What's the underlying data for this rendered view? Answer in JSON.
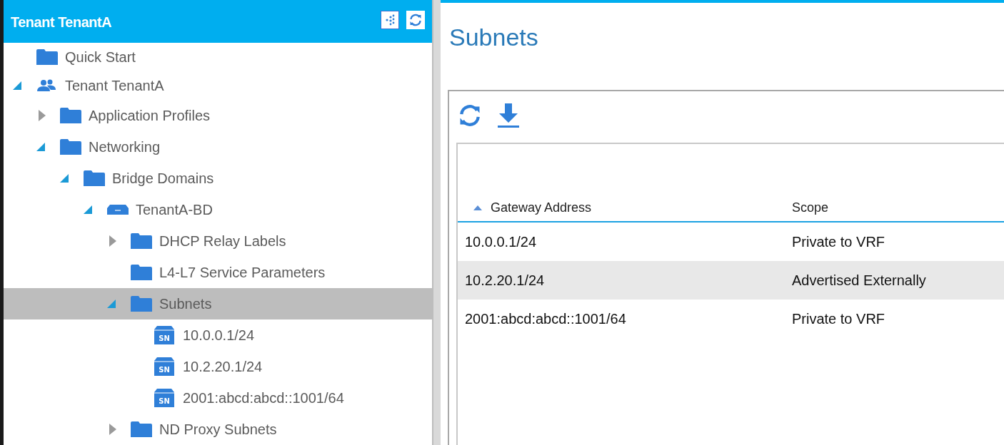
{
  "sidebar": {
    "title": "Tenant TenantA",
    "tree": [
      {
        "label": "Quick Start",
        "kind": "folder",
        "selected": false
      },
      {
        "label": "Tenant TenantA",
        "kind": "tenant",
        "expanded": true,
        "selected": false,
        "children": [
          {
            "label": "Application Profiles",
            "kind": "folder",
            "expanded": false,
            "selected": false
          },
          {
            "label": "Networking",
            "kind": "folder",
            "expanded": true,
            "selected": false,
            "children": [
              {
                "label": "Bridge Domains",
                "kind": "folder",
                "expanded": true,
                "selected": false,
                "children": [
                  {
                    "label": "TenantA-BD",
                    "kind": "bridge-domain",
                    "expanded": true,
                    "selected": false,
                    "children": [
                      {
                        "label": "DHCP Relay Labels",
                        "kind": "folder",
                        "expanded": false,
                        "selected": false
                      },
                      {
                        "label": "L4-L7 Service Parameters",
                        "kind": "folder",
                        "selected": false
                      },
                      {
                        "label": "Subnets",
                        "kind": "folder",
                        "expanded": true,
                        "selected": true,
                        "children": [
                          {
                            "label": "10.0.0.1/24",
                            "kind": "subnet",
                            "icon_label": "SN",
                            "selected": false
                          },
                          {
                            "label": "10.2.20.1/24",
                            "kind": "subnet",
                            "icon_label": "SN",
                            "selected": false
                          },
                          {
                            "label": "2001:abcd:abcd::1001/64",
                            "kind": "subnet",
                            "icon_label": "SN",
                            "selected": false
                          }
                        ]
                      },
                      {
                        "label": "ND Proxy Subnets",
                        "kind": "folder",
                        "expanded": false,
                        "selected": false
                      }
                    ]
                  }
                ]
              }
            ]
          }
        ]
      }
    ]
  },
  "main": {
    "title": "Subnets",
    "table": {
      "columns": [
        {
          "label": "Gateway Address",
          "sorted": true
        },
        {
          "label": "Scope",
          "sorted": false
        }
      ],
      "rows": [
        {
          "cells": [
            "10.0.0.1/24",
            "Private to VRF"
          ],
          "selected": false
        },
        {
          "cells": [
            "10.2.20.1/24",
            "Advertised Externally"
          ],
          "selected": true
        },
        {
          "cells": [
            "2001:abcd:abcd::1001/64",
            "Private to VRF"
          ],
          "selected": false
        }
      ]
    }
  }
}
